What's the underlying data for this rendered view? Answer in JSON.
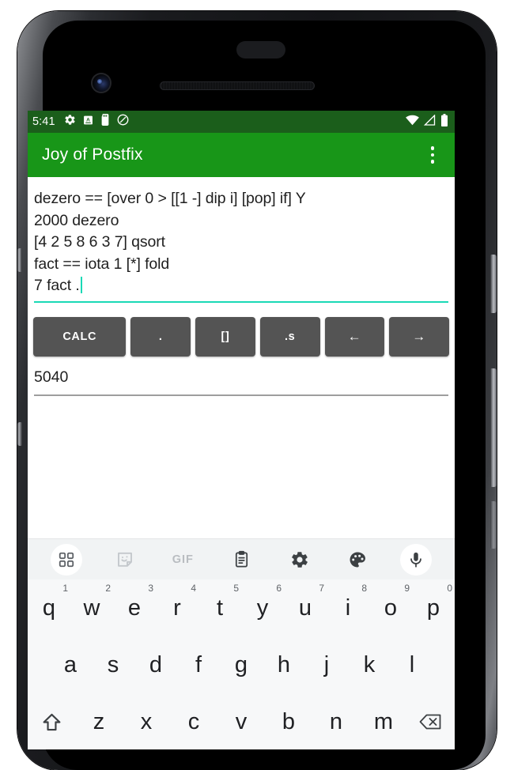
{
  "device": {
    "name": "android-phone-mockup",
    "frame_color": "#131417",
    "hardware": [
      "front-camera",
      "earpiece-grille",
      "power-button",
      "volume-button"
    ]
  },
  "status_bar": {
    "clock": "5:41",
    "background": "#1b5e1b",
    "left_icons": [
      "gear-icon",
      "letter-a-box-icon",
      "sd-card-icon",
      "do-not-disturb-icon"
    ],
    "right_icons": [
      "wifi-icon",
      "cell-signal-icon",
      "battery-icon"
    ]
  },
  "app_bar": {
    "title": "Joy of Postfix",
    "background": "#189618",
    "overflow_menu": "overflow-menu-icon"
  },
  "editor": {
    "lines": [
      "dezero == [over 0 > [[1 -] dip i] [pop] if] Y",
      "2000 dezero",
      "[4 2 5 8 6 3 7] qsort",
      "fact == iota 1 [*] fold",
      "7 fact ."
    ],
    "text": "dezero == [over 0 > [[1 -] dip i] [pop] if] Y\n2000 dezero\n[4 2 5 8 6 3 7] qsort\nfact == iota 1 [*] fold\n7 fact .",
    "caret_line": 5,
    "caret_after": "7 fact .",
    "accent_color": "#1ad9b6"
  },
  "buttons": [
    {
      "label": "CALC",
      "name": "calc-button"
    },
    {
      "label": ".",
      "name": "dot-button"
    },
    {
      "label": "[]",
      "name": "brackets-button"
    },
    {
      "label": ".s",
      "name": "dot-s-button"
    },
    {
      "label": "←",
      "name": "left-arrow-button"
    },
    {
      "label": "→",
      "name": "right-arrow-button"
    }
  ],
  "output": {
    "value": "5040"
  },
  "keyboard": {
    "toolbar": [
      {
        "name": "apps-grid-icon",
        "label": ""
      },
      {
        "name": "sticker-icon",
        "label": ""
      },
      {
        "name": "gif-icon",
        "label": "GIF"
      },
      {
        "name": "clipboard-icon",
        "label": ""
      },
      {
        "name": "gear-icon",
        "label": ""
      },
      {
        "name": "palette-icon",
        "label": ""
      },
      {
        "name": "microphone-icon",
        "label": ""
      }
    ],
    "row1": [
      {
        "key": "q",
        "hint": "1"
      },
      {
        "key": "w",
        "hint": "2"
      },
      {
        "key": "e",
        "hint": "3"
      },
      {
        "key": "r",
        "hint": "4"
      },
      {
        "key": "t",
        "hint": "5"
      },
      {
        "key": "y",
        "hint": "6"
      },
      {
        "key": "u",
        "hint": "7"
      },
      {
        "key": "i",
        "hint": "8"
      },
      {
        "key": "o",
        "hint": "9"
      },
      {
        "key": "p",
        "hint": "0"
      }
    ],
    "row2": [
      {
        "key": "a"
      },
      {
        "key": "s"
      },
      {
        "key": "d"
      },
      {
        "key": "f"
      },
      {
        "key": "g"
      },
      {
        "key": "h"
      },
      {
        "key": "j"
      },
      {
        "key": "k"
      },
      {
        "key": "l"
      }
    ],
    "row3": [
      {
        "key": "",
        "name": "shift-key"
      },
      {
        "key": "z"
      },
      {
        "key": "x"
      },
      {
        "key": "c"
      },
      {
        "key": "v"
      },
      {
        "key": "b"
      },
      {
        "key": "n"
      },
      {
        "key": "m"
      },
      {
        "key": "",
        "name": "backspace-key"
      }
    ]
  }
}
